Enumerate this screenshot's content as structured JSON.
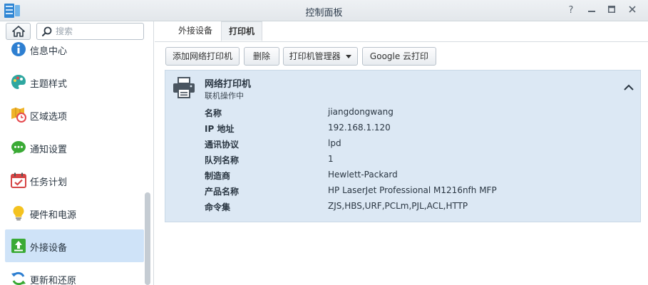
{
  "window": {
    "title": "控制面板"
  },
  "search": {
    "placeholder": "搜索"
  },
  "sidebar": {
    "items": [
      {
        "label": "信息中心",
        "icon": "info-icon"
      },
      {
        "label": "主题样式",
        "icon": "palette-icon"
      },
      {
        "label": "区域选项",
        "icon": "region-clock-icon"
      },
      {
        "label": "通知设置",
        "icon": "chat-bubble-icon"
      },
      {
        "label": "任务计划",
        "icon": "calendar-check-icon"
      },
      {
        "label": "硬件和电源",
        "icon": "lightbulb-icon"
      },
      {
        "label": "外接设备",
        "icon": "upload-icon",
        "active": true
      },
      {
        "label": "更新和还原",
        "icon": "refresh-icon"
      }
    ]
  },
  "tabs": [
    {
      "label": "外接设备"
    },
    {
      "label": "打印机",
      "active": true
    }
  ],
  "toolbar": {
    "add_label": "添加网络打印机",
    "delete_label": "删除",
    "manager_label": "打印机管理器",
    "google_label": "Google 云打印"
  },
  "printer": {
    "name": "网络打印机",
    "status": "联机操作中",
    "details": [
      {
        "key": "名称",
        "value": "jiangdongwang"
      },
      {
        "key": "IP 地址",
        "value": "192.168.1.120"
      },
      {
        "key": "通讯协议",
        "value": "lpd"
      },
      {
        "key": "队列名称",
        "value": "1"
      },
      {
        "key": "制造商",
        "value": "Hewlett-Packard"
      },
      {
        "key": "产品名称",
        "value": "HP LaserJet Professional M1216nfh MFP"
      },
      {
        "key": "命令集",
        "value": "ZJS,HBS,URF,PCLm,PJL,ACL,HTTP"
      }
    ]
  },
  "colors": {
    "accent": "#cfe3f8",
    "panel": "#dce8f4"
  }
}
